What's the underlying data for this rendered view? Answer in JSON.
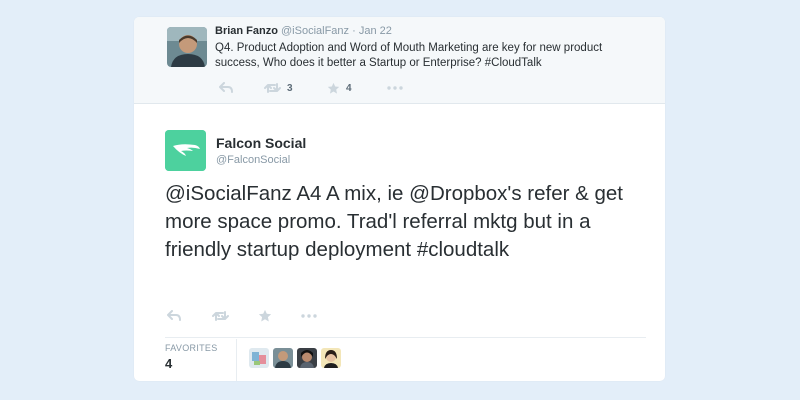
{
  "reply_tweet": {
    "author_name": "Brian Fanzo",
    "author_handle": "@iSocialFanz",
    "separator": "·",
    "date": "Jan 22",
    "text": "Q4. Product Adoption and Word of Mouth Marketing are key for new product success, Who does it better a Startup or Enterprise? #CloudTalk",
    "retweet_count": "3",
    "favorite_count": "4"
  },
  "main_tweet": {
    "author_name": "Falcon Social",
    "author_handle": "@FalconSocial",
    "text": "@iSocialFanz A4 A mix, ie @Dropbox's refer & get more space promo. Trad'l referral mktg but in a friendly startup deployment #cloudtalk",
    "favorites_label": "FAVORITES",
    "favorites_count": "4"
  },
  "colors": {
    "page_background": "#e3eef9",
    "falcon_brand": "#4dd19e",
    "icon_gray": "#ccd6dd"
  }
}
